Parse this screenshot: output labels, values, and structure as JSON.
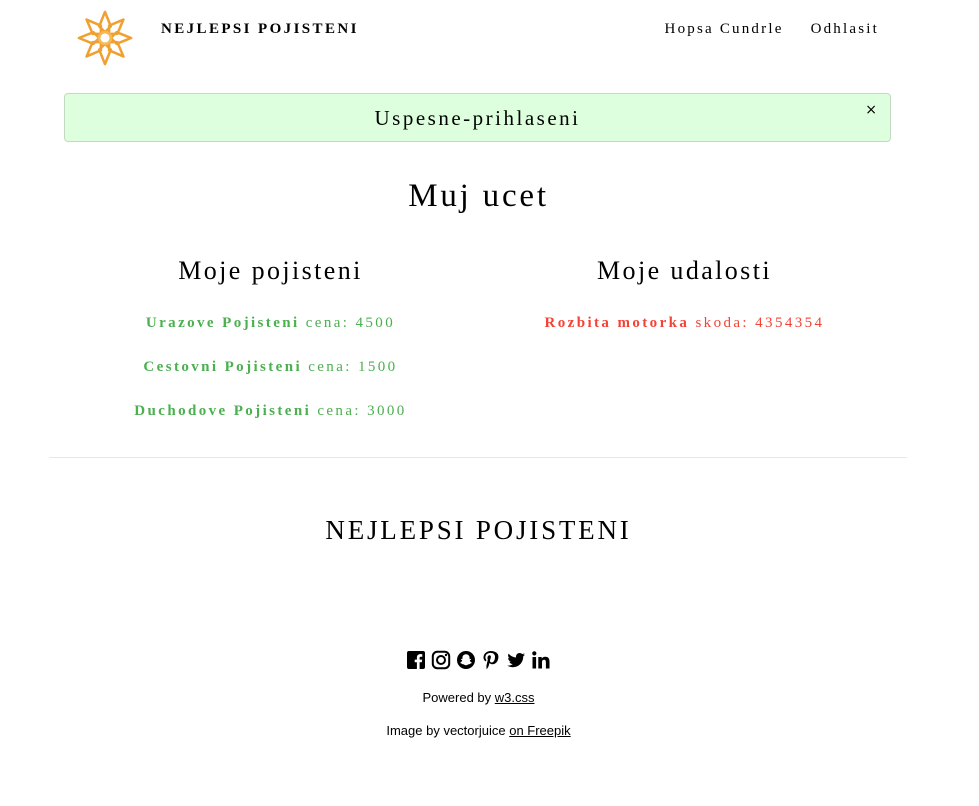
{
  "header": {
    "brand": "NEJLEPSI POJISTENI",
    "nav": {
      "user": "Hopsa Cundrle",
      "logout": "Odhlasit"
    }
  },
  "alert": {
    "message": "Uspesne-prihlaseni",
    "close": "×"
  },
  "main": {
    "title": "Muj ucet",
    "insurances": {
      "heading": "Moje pojisteni",
      "items": [
        {
          "name": "Urazove Pojisteni",
          "price": "cena: 4500"
        },
        {
          "name": "Cestovni Pojisteni",
          "price": "cena: 1500"
        },
        {
          "name": "Duchodove Pojisteni",
          "price": "cena: 3000"
        }
      ]
    },
    "events": {
      "heading": "Moje udalosti",
      "items": [
        {
          "name": "Rozbita motorka",
          "damage": "skoda: 4354354"
        }
      ]
    }
  },
  "footer": {
    "brand": "NEJLEPSI POJISTENI",
    "socials": [
      "facebook-icon",
      "instagram-icon",
      "snapchat-icon",
      "pinterest-icon",
      "twitter-icon",
      "linkedin-icon"
    ],
    "powered_prefix": "Powered by",
    "powered_link": "w3.css",
    "image_prefix": "Image by vectorjuice",
    "image_link": "on Freepik"
  },
  "colors": {
    "accent_green": "#4caf50",
    "accent_red": "#f44336",
    "alert_bg": "#ddffdd",
    "logo_orange": "#f0a030"
  }
}
